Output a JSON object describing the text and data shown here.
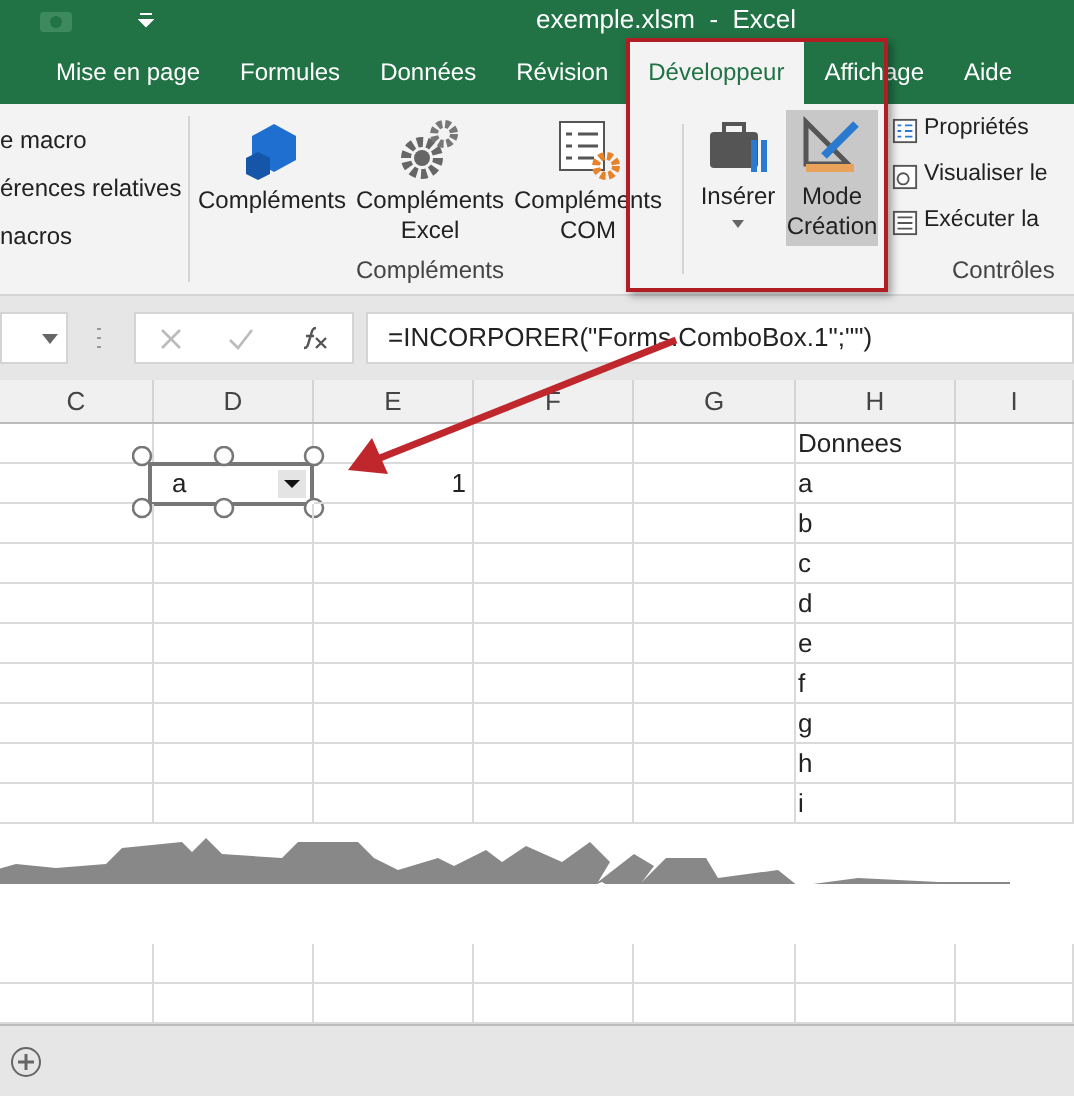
{
  "window": {
    "title": "exemple.xlsm  -  Excel"
  },
  "tabs": [
    {
      "label": "Mise en page",
      "selected": false
    },
    {
      "label": "Formules",
      "selected": false
    },
    {
      "label": "Données",
      "selected": false
    },
    {
      "label": "Révision",
      "selected": false
    },
    {
      "label": "Développeur",
      "selected": true
    },
    {
      "label": "Affichage",
      "selected": false
    },
    {
      "label": "Aide",
      "selected": false
    }
  ],
  "ribbon": {
    "code_group": {
      "items": [
        "e macro",
        "érences relatives",
        "nacros"
      ]
    },
    "addins_group": {
      "label": "Compléments",
      "buttons": [
        {
          "label": "Compléments",
          "kind": "cube"
        },
        {
          "label": "Compléments Excel",
          "kind": "gears"
        },
        {
          "label": "Compléments COM",
          "kind": "checklist"
        }
      ]
    },
    "controls_group": {
      "label": "Contrôles",
      "buttons": [
        {
          "label": "Insérer",
          "kind": "toolbox",
          "selected": false
        },
        {
          "label": "Mode Création",
          "kind": "design",
          "selected": true
        }
      ],
      "items": [
        {
          "label": "Propriétés",
          "kind": "properties"
        },
        {
          "label": "Visualiser le",
          "kind": "view-code"
        },
        {
          "label": "Exécuter la",
          "kind": "run"
        }
      ]
    }
  },
  "formula_bar": {
    "formula": "=INCORPORER(\"Forms.ComboBox.1\";\"\")"
  },
  "columns": [
    "C",
    "D",
    "E",
    "F",
    "G",
    "H",
    "I"
  ],
  "combo_box": {
    "value": "a",
    "selected": true
  },
  "rows": [
    {
      "column_h": "Donnees"
    },
    {
      "column_e": "1",
      "column_h": "a"
    },
    {
      "column_h": "b"
    },
    {
      "column_h": "c"
    },
    {
      "column_h": "d"
    },
    {
      "column_h": "e"
    },
    {
      "column_h": "f"
    },
    {
      "column_h": "g"
    },
    {
      "column_h": "h"
    },
    {
      "column_h": "i"
    }
  ]
}
